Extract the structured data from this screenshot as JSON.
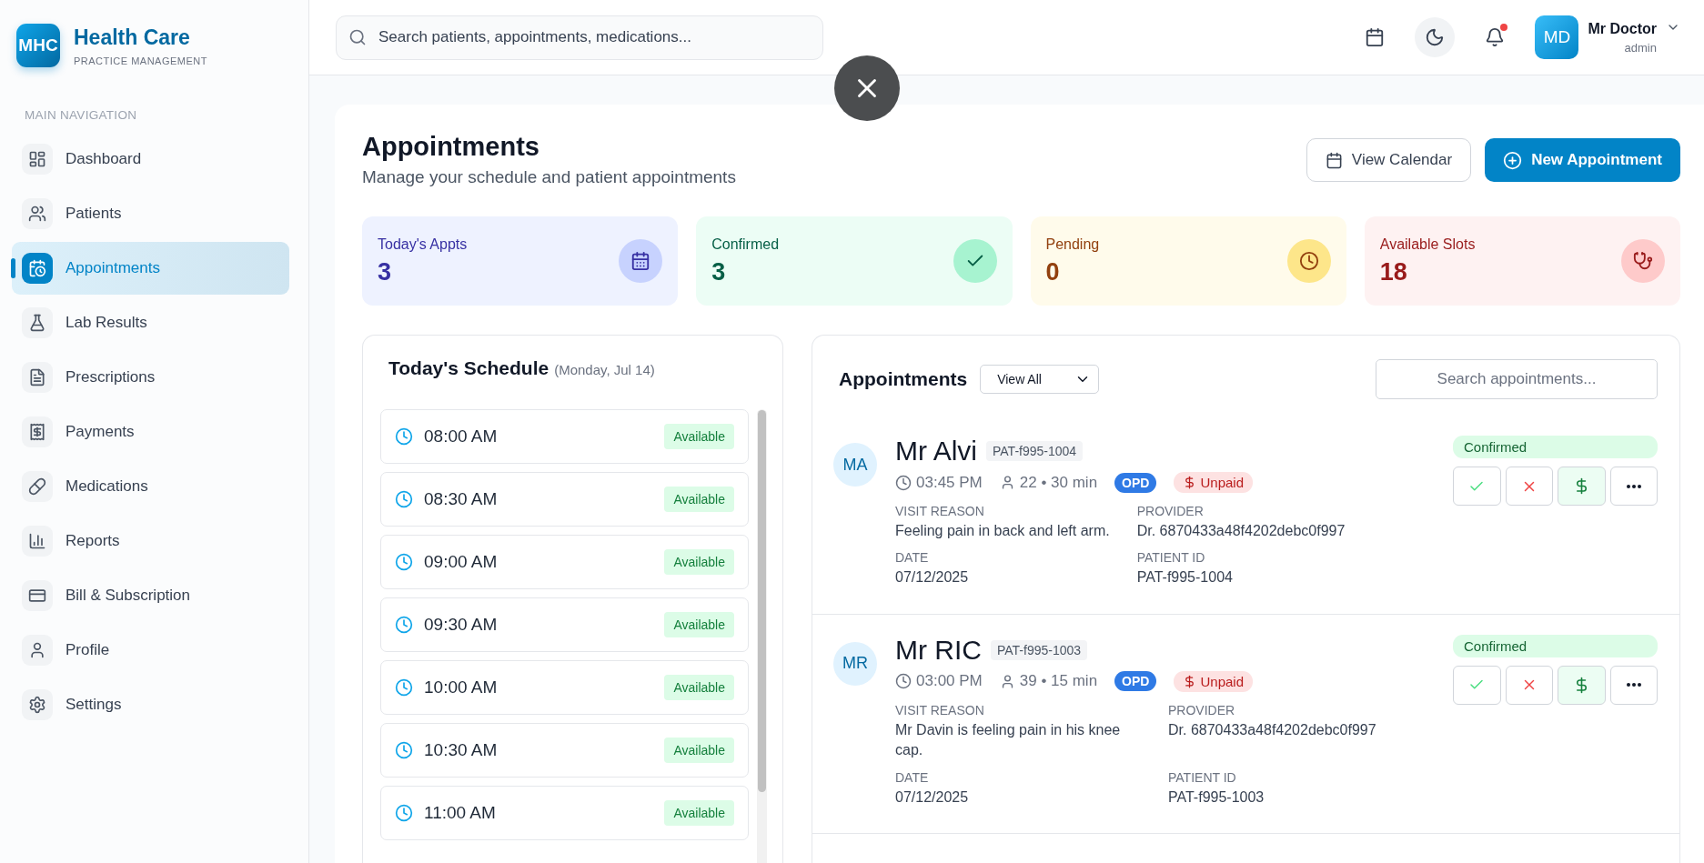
{
  "sidebar": {
    "logo": "MHC",
    "title": "Health Care",
    "subtitle": "PRACTICE MANAGEMENT",
    "section_label": "MAIN NAVIGATION",
    "items": [
      {
        "label": "Dashboard",
        "selected": false
      },
      {
        "label": "Patients",
        "selected": false
      },
      {
        "label": "Appointments",
        "selected": true
      },
      {
        "label": "Lab Results",
        "selected": false
      },
      {
        "label": "Prescriptions",
        "selected": false
      },
      {
        "label": "Payments",
        "selected": false
      },
      {
        "label": "Medications",
        "selected": false
      },
      {
        "label": "Reports",
        "selected": false
      },
      {
        "label": "Bill & Subscription",
        "selected": false
      },
      {
        "label": "Profile",
        "selected": false
      },
      {
        "label": "Settings",
        "selected": false
      }
    ]
  },
  "topbar": {
    "search": {
      "placeholder": "Search patients, appointments, medications..."
    },
    "has_notifications": true,
    "user": {
      "initials": "MD",
      "name": "Mr Doctor",
      "role": "admin"
    }
  },
  "close_button": true,
  "page": {
    "title": "Appointments",
    "subtitle": "Manage your schedule and patient appointments",
    "buttons": [
      {
        "label": "View Calendar",
        "kind": "secondary"
      },
      {
        "label": "New Appointment",
        "kind": "primary"
      }
    ]
  },
  "stats": [
    {
      "label": "Today's Appts",
      "value": "3",
      "color": "#3730a3"
    },
    {
      "label": "Confirmed",
      "value": "3",
      "color": "#065f46"
    },
    {
      "label": "Pending",
      "value": "0",
      "color": "#92400e"
    },
    {
      "label": "Available Slots",
      "value": "18",
      "color": "#991b1b"
    }
  ],
  "schedule": {
    "title": "Today's Schedule",
    "date": "(Monday, Jul 14)",
    "slots": [
      {
        "time": "08:00 AM",
        "status": "Available"
      },
      {
        "time": "08:30 AM",
        "status": "Available"
      },
      {
        "time": "09:00 AM",
        "status": "Available"
      },
      {
        "time": "09:30 AM",
        "status": "Available"
      },
      {
        "time": "10:00 AM",
        "status": "Available"
      },
      {
        "time": "10:30 AM",
        "status": "Available"
      },
      {
        "time": "11:00 AM",
        "status": "Available"
      }
    ]
  },
  "appointments": {
    "title": "Appointments",
    "filter": {
      "value": "View All"
    },
    "search": {
      "placeholder": "Search appointments..."
    },
    "items": [
      {
        "initials": "MA",
        "name": "Mr Alvi",
        "tag": "PAT-f995-1004",
        "time": "03:45 PM",
        "age_duration": "22 • 30 min",
        "type": "OPD",
        "payment": "Unpaid",
        "status": "Confirmed",
        "fields": [
          {
            "label": "VISIT REASON",
            "value": "Feeling pain in back and left arm."
          },
          {
            "label": "PROVIDER",
            "value": "Dr. 6870433a48f4202debc0f997"
          },
          {
            "label": "DATE",
            "value": "07/12/2025"
          },
          {
            "label": "PATIENT ID",
            "value": "PAT-f995-1004"
          }
        ]
      },
      {
        "initials": "MR",
        "name": "Mr RIC",
        "tag": "PAT-f995-1003",
        "time": "03:00 PM",
        "age_duration": "39 • 15 min",
        "type": "OPD",
        "payment": "Unpaid",
        "status": "Confirmed",
        "fields": [
          {
            "label": "VISIT REASON",
            "value": "Mr Davin is feeling pain in his knee cap."
          },
          {
            "label": "PROVIDER",
            "value": "Dr. 6870433a48f4202debc0f997"
          },
          {
            "label": "DATE",
            "value": "07/12/2025"
          },
          {
            "label": "PATIENT ID",
            "value": "PAT-f995-1003"
          }
        ]
      }
    ]
  }
}
